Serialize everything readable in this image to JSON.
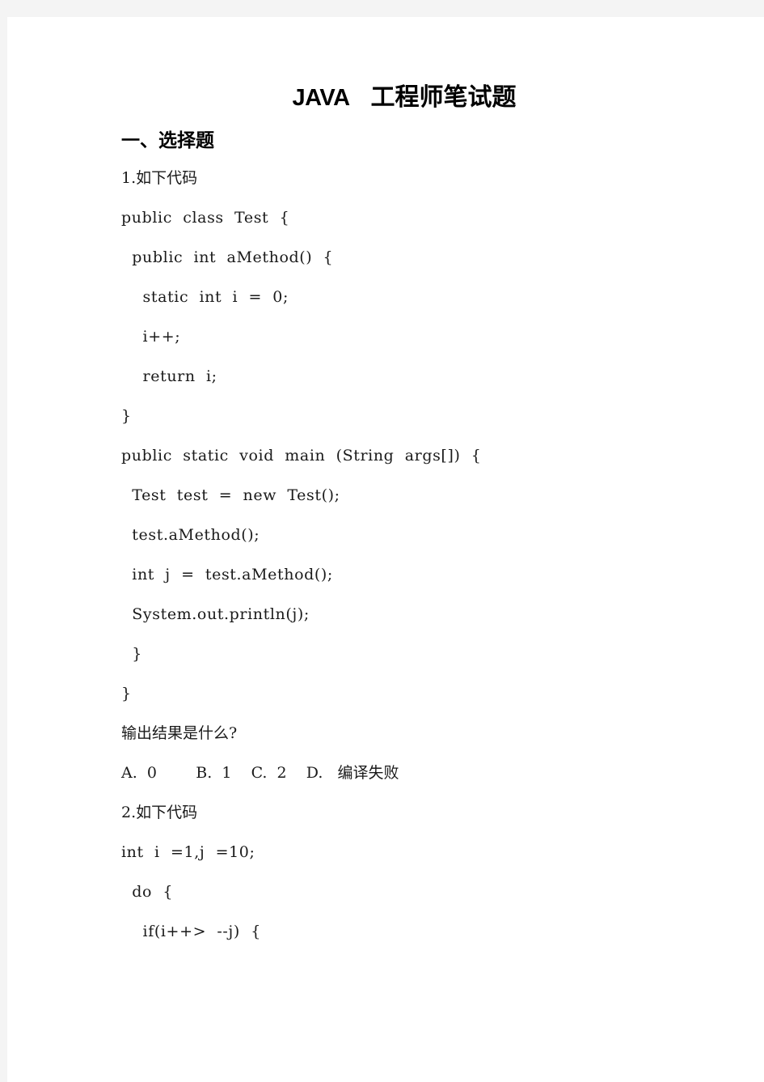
{
  "document": {
    "title": {
      "latin": "JAVA",
      "cjk": "工程师笔试题"
    },
    "section_heading": "一、选择题",
    "questions": [
      {
        "number_label": "1.如下代码",
        "code_lines": [
          "public  class  Test  {",
          "  public  int  aMethod()  {",
          "    static  int  i  =  0;",
          "    i++;",
          "    return  i;",
          "}",
          "public  static  void  main  (String  args[])  {",
          "  Test  test  =  new  Test();",
          "  test.aMethod();",
          "  int  j  =  test.aMethod();",
          "  System.out.println(j);",
          "  }",
          "}"
        ],
        "prompt": "输出结果是什么?",
        "options_line": "A.  0        B.  1    C.  2    D.   编译失败",
        "options": [
          {
            "key": "A.",
            "value": "0"
          },
          {
            "key": "B.",
            "value": "1"
          },
          {
            "key": "C.",
            "value": "2"
          },
          {
            "key": "D.",
            "value": "编译失败"
          }
        ]
      },
      {
        "number_label": "2.如下代码",
        "code_lines": [
          "int  i  =1,j  =10;",
          "  do  {",
          "    if(i++>  --j)  {"
        ]
      }
    ]
  },
  "colors": {
    "page_background": "#f4f4f4",
    "sheet": "#ffffff",
    "text": "#1a1a1a",
    "heading": "#000000"
  }
}
